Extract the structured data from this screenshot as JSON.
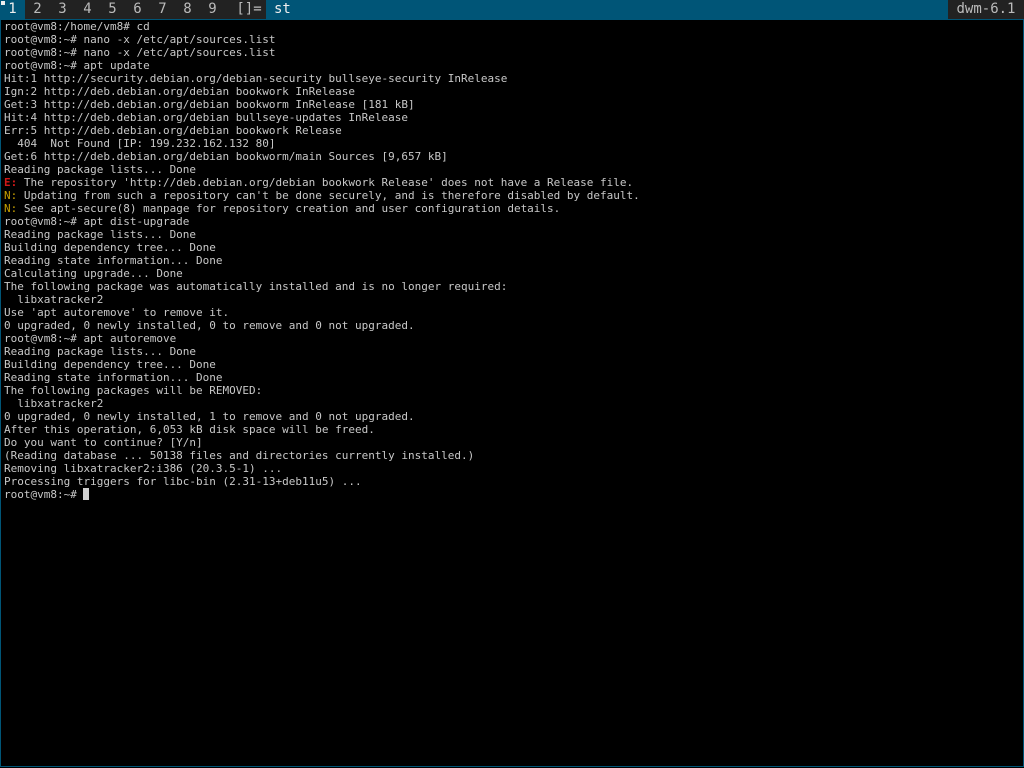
{
  "topbar": {
    "tags": [
      "1",
      "2",
      "3",
      "4",
      "5",
      "6",
      "7",
      "8",
      "9"
    ],
    "selected_tag": "1",
    "layout_symbol": "[]=",
    "window_title": "st",
    "status_text": "dwm-6.1"
  },
  "colors": {
    "bar_bg": "#222222",
    "accent": "#005577",
    "terminal_bg": "#000000",
    "error": "#d01818",
    "notice": "#c8a000"
  },
  "terminal": {
    "lines": [
      {
        "text": "root@vm8:/home/vm8# cd"
      },
      {
        "text": "root@vm8:~# nano -x /etc/apt/sources.list"
      },
      {
        "text": "root@vm8:~# nano -x /etc/apt/sources.list"
      },
      {
        "text": "root@vm8:~# apt update"
      },
      {
        "text": "Hit:1 http://security.debian.org/debian-security bullseye-security InRelease"
      },
      {
        "text": "Ign:2 http://deb.debian.org/debian bookwork InRelease"
      },
      {
        "text": "Get:3 http://deb.debian.org/debian bookworm InRelease [181 kB]"
      },
      {
        "text": "Hit:4 http://deb.debian.org/debian bullseye-updates InRelease"
      },
      {
        "text": "Err:5 http://deb.debian.org/debian bookwork Release"
      },
      {
        "text": "  404  Not Found [IP: 199.232.162.132 80]"
      },
      {
        "text": "Get:6 http://deb.debian.org/debian bookworm/main Sources [9,657 kB]"
      },
      {
        "text": "Reading package lists... Done"
      },
      {
        "prefix": "E:",
        "prefix_class": "err",
        "text": " The repository 'http://deb.debian.org/debian bookwork Release' does not have a Release file."
      },
      {
        "prefix": "N:",
        "prefix_class": "notice",
        "text": " Updating from such a repository can't be done securely, and is therefore disabled by default."
      },
      {
        "prefix": "N:",
        "prefix_class": "notice",
        "text": " See apt-secure(8) manpage for repository creation and user configuration details."
      },
      {
        "text": "root@vm8:~# apt dist-upgrade"
      },
      {
        "text": "Reading package lists... Done"
      },
      {
        "text": "Building dependency tree... Done"
      },
      {
        "text": "Reading state information... Done"
      },
      {
        "text": "Calculating upgrade... Done"
      },
      {
        "text": "The following package was automatically installed and is no longer required:"
      },
      {
        "text": "  libxatracker2"
      },
      {
        "text": "Use 'apt autoremove' to remove it."
      },
      {
        "text": "0 upgraded, 0 newly installed, 0 to remove and 0 not upgraded."
      },
      {
        "text": "root@vm8:~# apt autoremove"
      },
      {
        "text": "Reading package lists... Done"
      },
      {
        "text": "Building dependency tree... Done"
      },
      {
        "text": "Reading state information... Done"
      },
      {
        "text": "The following packages will be REMOVED:"
      },
      {
        "text": "  libxatracker2"
      },
      {
        "text": "0 upgraded, 0 newly installed, 1 to remove and 0 not upgraded."
      },
      {
        "text": "After this operation, 6,053 kB disk space will be freed."
      },
      {
        "text": "Do you want to continue? [Y/n]"
      },
      {
        "text": "(Reading database ... 50138 files and directories currently installed.)"
      },
      {
        "text": "Removing libxatracker2:i386 (20.3.5-1) ..."
      },
      {
        "text": "Processing triggers for libc-bin (2.31-13+deb11u5) ..."
      }
    ],
    "prompt": "root@vm8:~# "
  }
}
